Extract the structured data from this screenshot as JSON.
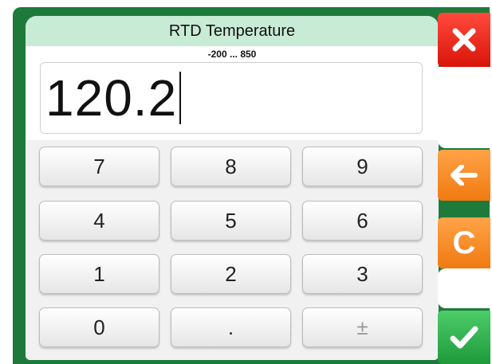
{
  "dialog": {
    "title": "RTD Temperature",
    "range": "-200 ... 850"
  },
  "display": {
    "value": "120.2"
  },
  "keypad": {
    "keys": [
      "7",
      "8",
      "9",
      "4",
      "5",
      "6",
      "1",
      "2",
      "3",
      "0",
      ".",
      "±"
    ]
  },
  "side_buttons": {
    "cancel_icon": "close-icon",
    "backspace_icon": "arrow-left-icon",
    "clear_label": "C",
    "accept_icon": "checkmark-icon"
  },
  "colors": {
    "frame": "#1e7a3a",
    "titlebar": "#c8ebd6",
    "cancel": "#e8241a",
    "action": "#f58a20",
    "accept": "#2eb04b"
  }
}
